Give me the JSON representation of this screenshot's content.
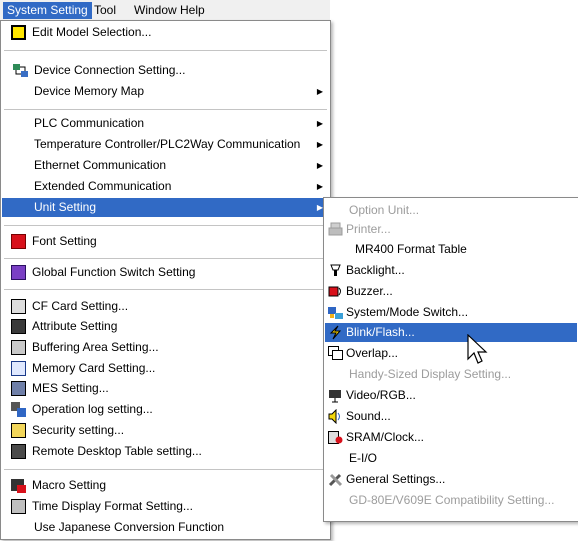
{
  "menubar": [
    "System Setting",
    "Tool",
    "Window",
    "Help"
  ],
  "main_menu": {
    "edit_model": "Edit Model Selection...",
    "device_connection": "Device Connection Setting...",
    "device_memory_map": "Device Memory Map",
    "plc_comm": "PLC Communication",
    "temp_ctrl": "Temperature Controller/PLC2Way Communication",
    "ethernet": "Ethernet Communication",
    "extended": "Extended Communication",
    "unit_setting": "Unit Setting",
    "font": "Font Setting",
    "global_fn": "Global Function Switch Setting",
    "cf_card": "CF Card Setting...",
    "attribute": "Attribute Setting",
    "buffering": "Buffering Area Setting...",
    "memory_card": "Memory Card Setting...",
    "mes": "MES Setting...",
    "op_log": "Operation log setting...",
    "security": "Security setting...",
    "remote_desktop": "Remote Desktop Table setting...",
    "macro": "Macro Setting",
    "time_display": "Time Display Format Setting...",
    "japanese": "Use Japanese Conversion Function"
  },
  "unit_menu": {
    "option_unit": "Option Unit...",
    "printer": "Printer...",
    "mr400": "MR400 Format Table",
    "backlight": "Backlight...",
    "buzzer": "Buzzer...",
    "system_mode": "System/Mode Switch...",
    "blink": "Blink/Flash...",
    "overlap": "Overlap...",
    "handy": "Handy-Sized Display Setting...",
    "video": "Video/RGB...",
    "sound": "Sound...",
    "sram": "SRAM/Clock...",
    "eio": "E-I/O",
    "general": "General Settings...",
    "gd80e": "GD-80E/V609E Compatibility Setting..."
  },
  "colors": {
    "highlight": "#316ac5",
    "disabled": "#9c9c9c"
  }
}
